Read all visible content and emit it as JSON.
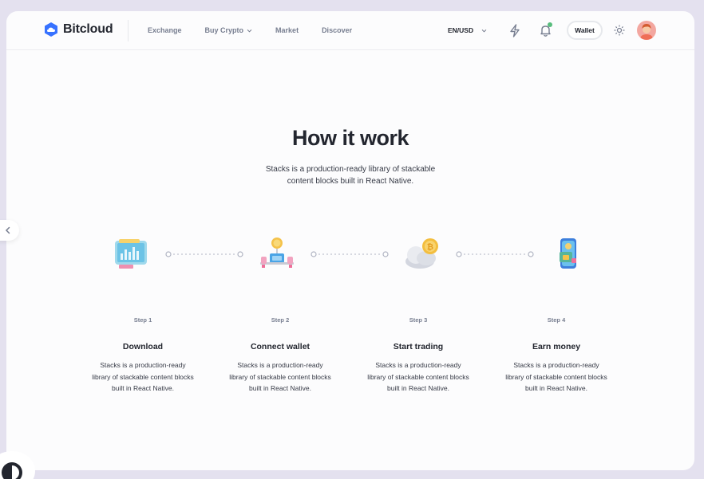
{
  "brand": {
    "name": "Bitcloud",
    "color": "#3772ff"
  },
  "nav": [
    {
      "label": "Exchange",
      "has_dropdown": false
    },
    {
      "label": "Buy Crypto",
      "has_dropdown": true
    },
    {
      "label": "Market",
      "has_dropdown": false
    },
    {
      "label": "Discover",
      "has_dropdown": false
    }
  ],
  "header": {
    "language": "EN/USD",
    "wallet_label": "Wallet",
    "notification_dot_color": "#58bd7d",
    "icons": [
      "lightning-icon",
      "bell-icon",
      "sun-icon"
    ]
  },
  "section": {
    "title": "How it work",
    "subtitle_line1": "Stacks is a production-ready library of stackable",
    "subtitle_line2": "content blocks built in React Native."
  },
  "steps": [
    {
      "num": "Step 1",
      "title": "Download",
      "illus": "computer-illustration",
      "desc_line1": "Stacks is a production-ready",
      "desc_line2": "library of stackable content blocks",
      "desc_line3": "built in React Native."
    },
    {
      "num": "Step 2",
      "title": "Connect wallet",
      "illus": "wallet-connect-illustration",
      "desc_line1": "Stacks is a production-ready",
      "desc_line2": "library of stackable content blocks",
      "desc_line3": "built in React Native."
    },
    {
      "num": "Step 3",
      "title": "Start trading",
      "illus": "coin-cloud-illustration",
      "desc_line1": "Stacks is a production-ready",
      "desc_line2": "library of stackable content blocks",
      "desc_line3": "built in React Native."
    },
    {
      "num": "Step 4",
      "title": "Earn money",
      "illus": "phone-wallet-illustration",
      "desc_line1": "Stacks is a production-ready",
      "desc_line2": "library of stackable content blocks",
      "desc_line3": "built in React Native."
    }
  ],
  "colors": {
    "background": "#e4e1ef",
    "card": "#fcfcfd",
    "text_primary": "#23262f",
    "text_secondary": "#777e90",
    "connector": "#b1b5c3"
  }
}
